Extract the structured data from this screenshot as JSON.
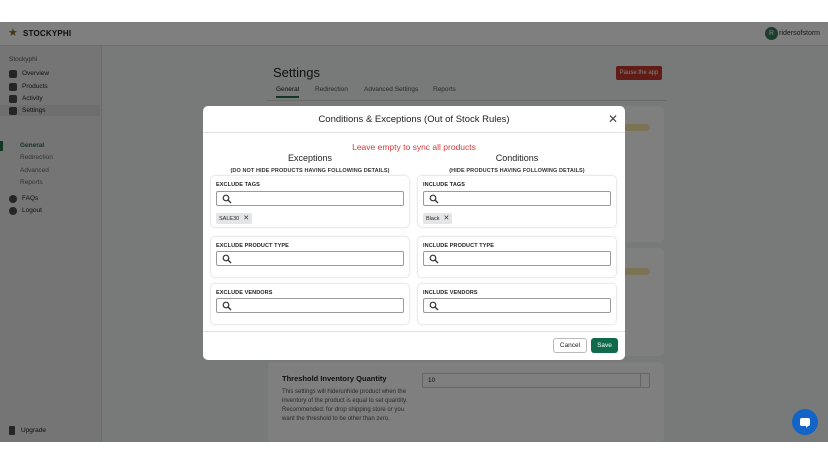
{
  "app": {
    "brand": "STOCKYPHI",
    "user": {
      "initial": "R",
      "name": "ridersofstorm"
    }
  },
  "sidebar": {
    "section": "Stockyphi",
    "items": [
      {
        "label": "Overview"
      },
      {
        "label": "Products"
      },
      {
        "label": "Activity"
      },
      {
        "label": "Settings"
      }
    ],
    "sub_items": [
      {
        "label": "General"
      },
      {
        "label": "Redirection"
      },
      {
        "label": "Advanced"
      },
      {
        "label": "Reports"
      }
    ],
    "bottom_items": [
      {
        "label": "FAQs"
      },
      {
        "label": "Logout"
      }
    ],
    "upgrade": "Upgrade"
  },
  "page": {
    "title": "Settings",
    "pause_label": "Pause the app",
    "tabs": [
      {
        "label": "General"
      },
      {
        "label": "Redirection"
      },
      {
        "label": "Advanced Settings"
      },
      {
        "label": "Reports"
      }
    ],
    "threshold": {
      "title": "Threshold Inventory Quantity",
      "description": "This settings will hide/unhide product when the inventory of the product is equal to set quantity. Recommended: for drop shipping store or you want the threshold to be other than zero.",
      "value": "10"
    }
  },
  "modal": {
    "title": "Conditions & Exceptions (Out of Stock Rules)",
    "hint": "Leave empty to sync all products",
    "exceptions": {
      "title": "Exceptions",
      "subtitle": "(DO NOT HIDE PRODUCTS HAVING FOLLOWING DETAILS)",
      "fields": [
        {
          "label": "EXCLUDE TAGS",
          "value": "",
          "tags": [
            "SALE30"
          ]
        },
        {
          "label": "EXCLUDE PRODUCT TYPE",
          "value": "",
          "tags": []
        },
        {
          "label": "EXCLUDE VENDORS",
          "value": "",
          "tags": []
        }
      ]
    },
    "conditions": {
      "title": "Conditions",
      "subtitle": "(HIDE PRODUCTS HAVING FOLLOWING DETAILS)",
      "fields": [
        {
          "label": "INCLUDE TAGS",
          "value": "",
          "tags": [
            "Black"
          ]
        },
        {
          "label": "INCLUDE PRODUCT TYPE",
          "value": "",
          "tags": []
        },
        {
          "label": "INCLUDE VENDORS",
          "value": "",
          "tags": []
        }
      ]
    },
    "cancel_label": "Cancel",
    "save_label": "Save"
  }
}
